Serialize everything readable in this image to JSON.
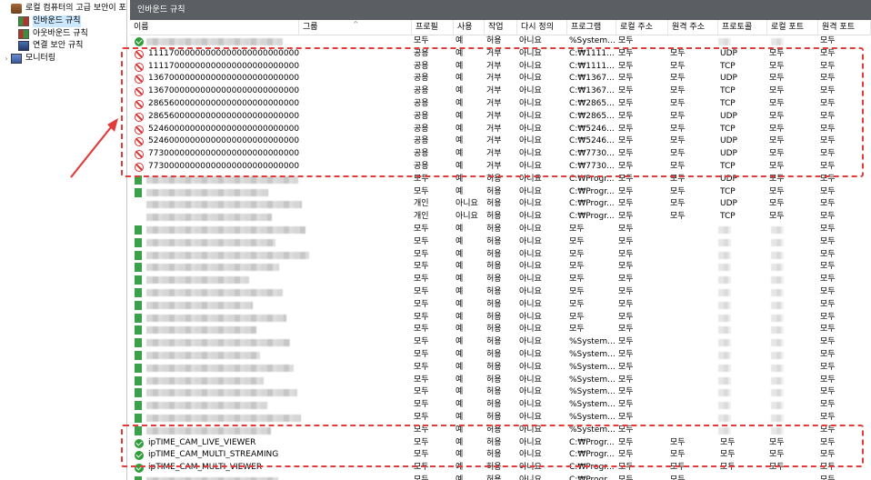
{
  "tree": {
    "items": [
      {
        "label": "로컬 컴퓨터의 고급 보안이 포",
        "icon": "firewall-shield-icon",
        "expander": ""
      },
      {
        "label": "인바운드 규칙",
        "icon": "inbound-rules-icon",
        "expander": ""
      },
      {
        "label": "아웃바운드 규칙",
        "icon": "outbound-rules-icon",
        "expander": ""
      },
      {
        "label": "연결 보안 규칙",
        "icon": "connection-security-icon",
        "expander": ""
      },
      {
        "label": "모니터링",
        "icon": "monitor-icon",
        "expander": "›"
      }
    ]
  },
  "pane": {
    "title": "인바운드 규칙"
  },
  "columns": [
    {
      "key": "name",
      "label": "이름"
    },
    {
      "key": "group",
      "label": "그룹"
    },
    {
      "key": "profile",
      "label": "프로필"
    },
    {
      "key": "enabled",
      "label": "사용"
    },
    {
      "key": "action",
      "label": "작업"
    },
    {
      "key": "override",
      "label": "다시 정의"
    },
    {
      "key": "program",
      "label": "프로그램"
    },
    {
      "key": "local_addr",
      "label": "로컬 주소"
    },
    {
      "key": "remote_addr",
      "label": "원격 주소"
    },
    {
      "key": "protocol",
      "label": "프로토콜"
    },
    {
      "key": "local_port",
      "label": "로컬 포트"
    },
    {
      "key": "remote_port",
      "label": "원격 포트"
    }
  ],
  "sort_indicator": "^",
  "rows": [
    {
      "status": "allow",
      "name": "",
      "blur": true,
      "profile": "모두",
      "enabled": "예",
      "action": "허용",
      "override": "아니요",
      "program": "%System...",
      "local_addr": "모두",
      "remote_addr": "",
      "protocol": "",
      "local_port": "",
      "remote_port": "모두"
    },
    {
      "status": "block",
      "name": "1111700000000000000000000000000...",
      "profile": "공용",
      "enabled": "예",
      "action": "거부",
      "override": "아니요",
      "program": "C:₩1111...",
      "local_addr": "모두",
      "remote_addr": "모두",
      "protocol": "UDP",
      "local_port": "모두",
      "remote_port": "모두"
    },
    {
      "status": "block",
      "name": "1111700000000000000000000000000...",
      "profile": "공용",
      "enabled": "예",
      "action": "거부",
      "override": "아니요",
      "program": "C:₩1111...",
      "local_addr": "모두",
      "remote_addr": "모두",
      "protocol": "TCP",
      "local_port": "모두",
      "remote_port": "모두"
    },
    {
      "status": "block",
      "name": "1367000000000000000000000000000...",
      "profile": "공용",
      "enabled": "예",
      "action": "거부",
      "override": "아니요",
      "program": "C:₩1367...",
      "local_addr": "모두",
      "remote_addr": "모두",
      "protocol": "UDP",
      "local_port": "모두",
      "remote_port": "모두"
    },
    {
      "status": "block",
      "name": "1367000000000000000000000000000...",
      "profile": "공용",
      "enabled": "예",
      "action": "거부",
      "override": "아니요",
      "program": "C:₩1367...",
      "local_addr": "모두",
      "remote_addr": "모두",
      "protocol": "TCP",
      "local_port": "모두",
      "remote_port": "모두"
    },
    {
      "status": "block",
      "name": "2865600000000000000000000000000...",
      "profile": "공용",
      "enabled": "예",
      "action": "거부",
      "override": "아니요",
      "program": "C:₩2865...",
      "local_addr": "모두",
      "remote_addr": "모두",
      "protocol": "TCP",
      "local_port": "모두",
      "remote_port": "모두"
    },
    {
      "status": "block",
      "name": "2865600000000000000000000000000...",
      "profile": "공용",
      "enabled": "예",
      "action": "거부",
      "override": "아니요",
      "program": "C:₩2865...",
      "local_addr": "모두",
      "remote_addr": "모두",
      "protocol": "UDP",
      "local_port": "모두",
      "remote_port": "모두"
    },
    {
      "status": "block",
      "name": "5246000000000000000000000000000...",
      "profile": "공용",
      "enabled": "예",
      "action": "거부",
      "override": "아니요",
      "program": "C:₩5246...",
      "local_addr": "모두",
      "remote_addr": "모두",
      "protocol": "TCP",
      "local_port": "모두",
      "remote_port": "모두"
    },
    {
      "status": "block",
      "name": "5246000000000000000000000000000...",
      "profile": "공용",
      "enabled": "예",
      "action": "거부",
      "override": "아니요",
      "program": "C:₩5246...",
      "local_addr": "모두",
      "remote_addr": "모두",
      "protocol": "UDP",
      "local_port": "모두",
      "remote_port": "모두"
    },
    {
      "status": "block",
      "name": "7730000000000000000000000000000...",
      "profile": "공용",
      "enabled": "예",
      "action": "거부",
      "override": "아니요",
      "program": "C:₩7730...",
      "local_addr": "모두",
      "remote_addr": "모두",
      "protocol": "UDP",
      "local_port": "모두",
      "remote_port": "모두"
    },
    {
      "status": "block",
      "name": "7730000000000000000000000000000...",
      "profile": "공용",
      "enabled": "예",
      "action": "거부",
      "override": "아니요",
      "program": "C:₩7730...",
      "local_addr": "모두",
      "remote_addr": "모두",
      "protocol": "TCP",
      "local_port": "모두",
      "remote_port": "모두"
    },
    {
      "status": "green",
      "name": "",
      "blur": true,
      "profile": "모두",
      "enabled": "예",
      "action": "허용",
      "override": "아니요",
      "program": "C:₩Progr...",
      "local_addr": "모두",
      "remote_addr": "모두",
      "protocol": "UDP",
      "local_port": "모두",
      "remote_port": "모두"
    },
    {
      "status": "green",
      "name": "",
      "blur": true,
      "profile": "모두",
      "enabled": "예",
      "action": "허용",
      "override": "아니요",
      "program": "C:₩Progr...",
      "local_addr": "모두",
      "remote_addr": "모두",
      "protocol": "TCP",
      "local_port": "모두",
      "remote_port": "모두"
    },
    {
      "status": "none",
      "name": "",
      "blur": true,
      "profile": "개인",
      "enabled": "아니요",
      "action": "허용",
      "override": "아니요",
      "program": "C:₩Progr...",
      "local_addr": "모두",
      "remote_addr": "모두",
      "protocol": "UDP",
      "local_port": "모두",
      "remote_port": "모두"
    },
    {
      "status": "none",
      "name": "",
      "blur": true,
      "profile": "개인",
      "enabled": "아니요",
      "action": "허용",
      "override": "아니요",
      "program": "C:₩Progr...",
      "local_addr": "모두",
      "remote_addr": "모두",
      "protocol": "TCP",
      "local_port": "모두",
      "remote_port": "모두"
    },
    {
      "status": "green",
      "name": "",
      "blur": true,
      "profile": "모두",
      "enabled": "예",
      "action": "허용",
      "override": "아니요",
      "program": "모두",
      "local_addr": "모두",
      "remote_addr": "",
      "protocol": "",
      "local_port": "",
      "remote_port": "모두"
    },
    {
      "status": "green",
      "name": "",
      "blur": true,
      "profile": "모두",
      "enabled": "예",
      "action": "허용",
      "override": "아니요",
      "program": "모두",
      "local_addr": "모두",
      "remote_addr": "",
      "protocol": "",
      "local_port": "",
      "remote_port": "모두"
    },
    {
      "status": "green",
      "name": "",
      "blur": true,
      "profile": "모두",
      "enabled": "예",
      "action": "허용",
      "override": "아니요",
      "program": "모두",
      "local_addr": "모두",
      "remote_addr": "",
      "protocol": "",
      "local_port": "",
      "remote_port": "모두"
    },
    {
      "status": "green",
      "name": "",
      "blur": true,
      "profile": "모두",
      "enabled": "예",
      "action": "허용",
      "override": "아니요",
      "program": "모두",
      "local_addr": "모두",
      "remote_addr": "",
      "protocol": "",
      "local_port": "",
      "remote_port": "모두"
    },
    {
      "status": "green",
      "name": "",
      "blur": true,
      "profile": "모두",
      "enabled": "예",
      "action": "허용",
      "override": "아니요",
      "program": "모두",
      "local_addr": "모두",
      "remote_addr": "",
      "protocol": "",
      "local_port": "",
      "remote_port": "모두"
    },
    {
      "status": "green",
      "name": "",
      "blur": true,
      "profile": "모두",
      "enabled": "예",
      "action": "허용",
      "override": "아니요",
      "program": "모두",
      "local_addr": "모두",
      "remote_addr": "",
      "protocol": "",
      "local_port": "",
      "remote_port": "모두"
    },
    {
      "status": "green",
      "name": "",
      "blur": true,
      "profile": "모두",
      "enabled": "예",
      "action": "허용",
      "override": "아니요",
      "program": "모두",
      "local_addr": "모두",
      "remote_addr": "",
      "protocol": "",
      "local_port": "",
      "remote_port": "모두"
    },
    {
      "status": "green",
      "name": "",
      "blur": true,
      "profile": "모두",
      "enabled": "예",
      "action": "허용",
      "override": "아니요",
      "program": "모두",
      "local_addr": "모두",
      "remote_addr": "",
      "protocol": "",
      "local_port": "",
      "remote_port": "모두"
    },
    {
      "status": "green",
      "name": "",
      "blur": true,
      "profile": "모두",
      "enabled": "예",
      "action": "허용",
      "override": "아니요",
      "program": "모두",
      "local_addr": "모두",
      "remote_addr": "",
      "protocol": "",
      "local_port": "",
      "remote_port": "모두"
    },
    {
      "status": "green",
      "name": "",
      "blur": true,
      "profile": "모두",
      "enabled": "예",
      "action": "허용",
      "override": "아니요",
      "program": "%System...",
      "local_addr": "모두",
      "remote_addr": "",
      "protocol": "",
      "local_port": "",
      "remote_port": "모두"
    },
    {
      "status": "green",
      "name": "",
      "blur": true,
      "profile": "모두",
      "enabled": "예",
      "action": "허용",
      "override": "아니요",
      "program": "%System...",
      "local_addr": "모두",
      "remote_addr": "",
      "protocol": "",
      "local_port": "",
      "remote_port": "모두"
    },
    {
      "status": "green",
      "name": "",
      "blur": true,
      "profile": "모두",
      "enabled": "예",
      "action": "허용",
      "override": "아니요",
      "program": "%System...",
      "local_addr": "모두",
      "remote_addr": "",
      "protocol": "",
      "local_port": "",
      "remote_port": "모두"
    },
    {
      "status": "green",
      "name": "",
      "blur": true,
      "profile": "모두",
      "enabled": "예",
      "action": "허용",
      "override": "아니요",
      "program": "%System...",
      "local_addr": "모두",
      "remote_addr": "",
      "protocol": "",
      "local_port": "",
      "remote_port": "모두"
    },
    {
      "status": "green",
      "name": "",
      "blur": true,
      "profile": "모두",
      "enabled": "예",
      "action": "허용",
      "override": "아니요",
      "program": "%System...",
      "local_addr": "모두",
      "remote_addr": "",
      "protocol": "",
      "local_port": "",
      "remote_port": "모두"
    },
    {
      "status": "green",
      "name": "",
      "blur": true,
      "profile": "모두",
      "enabled": "예",
      "action": "허용",
      "override": "아니요",
      "program": "%System...",
      "local_addr": "모두",
      "remote_addr": "",
      "protocol": "",
      "local_port": "",
      "remote_port": "모두"
    },
    {
      "status": "green",
      "name": "",
      "blur": true,
      "profile": "모두",
      "enabled": "예",
      "action": "허용",
      "override": "아니요",
      "program": "%System...",
      "local_addr": "모두",
      "remote_addr": "",
      "protocol": "",
      "local_port": "",
      "remote_port": "모두"
    },
    {
      "status": "green",
      "name": "",
      "blur": true,
      "profile": "모두",
      "enabled": "예",
      "action": "허용",
      "override": "아니요",
      "program": "%System...",
      "local_addr": "모두",
      "remote_addr": "",
      "protocol": "",
      "local_port": "",
      "remote_port": "모두"
    },
    {
      "status": "allow",
      "name": "ipTIME_CAM_LIVE_VIEWER",
      "profile": "모두",
      "enabled": "예",
      "action": "허용",
      "override": "아니요",
      "program": "C:₩Progr...",
      "local_addr": "모두",
      "remote_addr": "모두",
      "protocol": "모두",
      "local_port": "모두",
      "remote_port": "모두"
    },
    {
      "status": "allow",
      "name": "ipTIME_CAM_MULTI_STREAMING",
      "profile": "모두",
      "enabled": "예",
      "action": "허용",
      "override": "아니요",
      "program": "C:₩Progr...",
      "local_addr": "모두",
      "remote_addr": "모두",
      "protocol": "모두",
      "local_port": "모두",
      "remote_port": "모두"
    },
    {
      "status": "allow",
      "name": "ipTIME_CAM_MULTI_VIEWER",
      "profile": "모두",
      "enabled": "예",
      "action": "허용",
      "override": "아니요",
      "program": "C:₩Progr...",
      "local_addr": "모두",
      "remote_addr": "모두",
      "protocol": "모두",
      "local_port": "모두",
      "remote_port": "모두"
    },
    {
      "status": "green",
      "name": "",
      "blur": true,
      "profile": "모두",
      "enabled": "예",
      "action": "허용",
      "override": "아니요",
      "program": "C:₩Progr...",
      "local_addr": "모두",
      "remote_addr": "모두",
      "protocol": "",
      "local_port": "",
      "remote_port": "모두"
    }
  ],
  "colors": {
    "highlight": "#e23b3b",
    "allow": "#2f9e3a",
    "block": "#d33333",
    "title_bar": "#5b5f63",
    "selection": "#cce8ff"
  }
}
